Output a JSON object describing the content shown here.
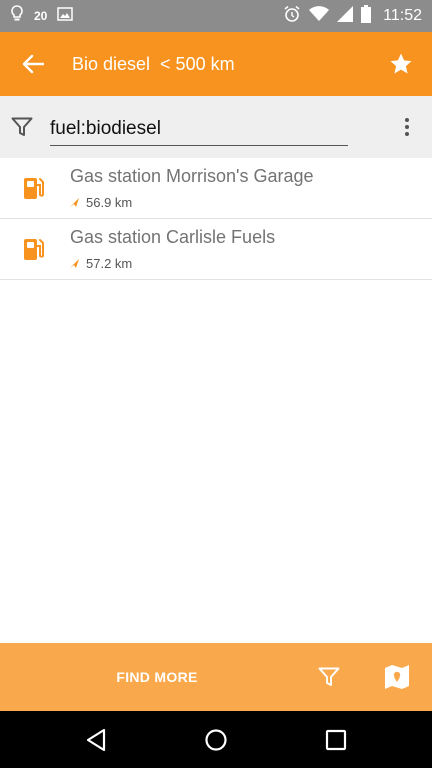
{
  "status_bar": {
    "notification_count": "20",
    "time": "11:52",
    "icons": [
      "lightbulb-icon",
      "image-icon",
      "alarm-icon",
      "wifi-icon",
      "signal-icon",
      "battery-icon"
    ]
  },
  "toolbar": {
    "title": "Bio diesel  < 500 km",
    "back_icon": "arrow-left-icon",
    "favorite_icon": "star-icon"
  },
  "filter": {
    "value": "fuel:biodiesel",
    "filter_icon": "filter-icon",
    "menu_icon": "overflow-menu-icon"
  },
  "results": [
    {
      "name": "Gas station Morrison's Garage",
      "distance": "56.9 km",
      "icon": "fuel-pump-icon"
    },
    {
      "name": "Gas station Carlisle Fuels",
      "distance": "57.2 km",
      "icon": "fuel-pump-icon"
    }
  ],
  "bottom_bar": {
    "find_more_label": "FIND MORE",
    "filter_icon": "filter-icon",
    "map_icon": "map-icon"
  },
  "nav_bar": {
    "icons": [
      "back-triangle-icon",
      "home-circle-icon",
      "recents-square-icon"
    ]
  },
  "colors": {
    "accent": "#f7931e",
    "bottom_bar": "#f9a84b",
    "status_bar": "#8c8c8c"
  }
}
